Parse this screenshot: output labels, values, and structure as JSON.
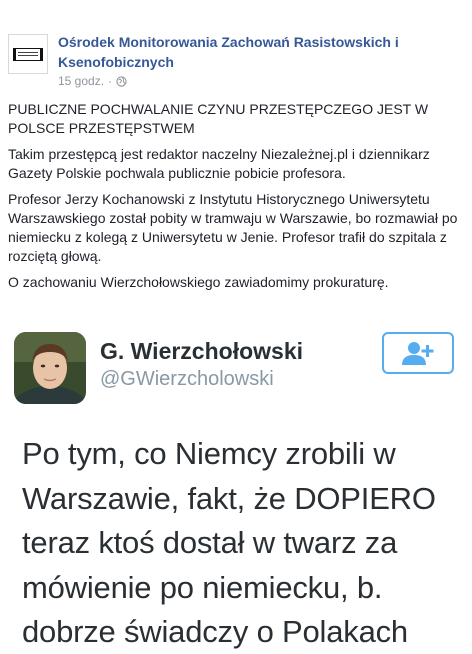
{
  "post": {
    "page_name": "Ośrodek Monitorowania Zachowań Rasistowskich i Ksenofobicznych",
    "timestamp": "15 godz.",
    "separator": "·",
    "paragraphs": [
      "PUBLICZNE POCHWALANIE CZYNU PRZESTĘPCZEGO JEST W POLSCE PRZESTĘPSTWEM",
      "Takim przestępcą jest redaktor naczelny Niezależnej.pl i dziennikarz Gazety Polskie pochwala publicznie pobicie profesora.",
      "Profesor Jerzy Kochanowski z Instytutu Historycznego Uniwersytetu Warszawskiego został pobity w tramwaju w Warszawie, bo rozmawiał po niemiecku z kolegą z Uniwersytetu w Jenie. Profesor trafił do szpitala z rozciętą głową.",
      "O zachowaniu Wierzchołowskiego zawiadomimy prokuraturę."
    ]
  },
  "tweet": {
    "name": "G. Wierzchołowski",
    "handle": "@GWierzcholowski",
    "text": "Po tym, co Niemcy zrobili w Warszawie, fakt, że DOPIERO teraz ktoś dostał w twarz za mówienie po niemiecku, b. dobrze świadczy o Polakach"
  },
  "colors": {
    "link_blue": "#365899",
    "meta_gray": "#90949c",
    "twitter_blue": "#55acee",
    "handle_gray": "#8899a6"
  },
  "icons": [
    "page-logo-icon",
    "globe-icon",
    "follow-user-icon"
  ]
}
